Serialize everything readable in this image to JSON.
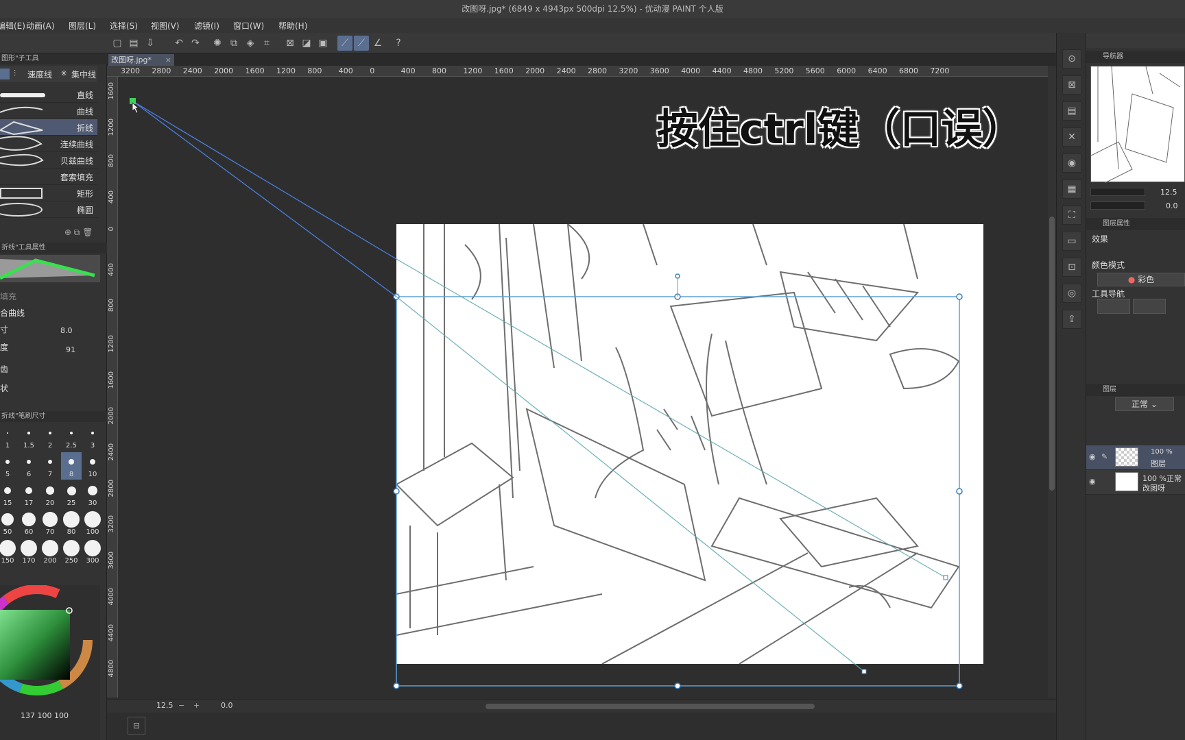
{
  "window": {
    "title": "改图呀.jpg* (6849 x 4943px 500dpi 12.5%)  - 优动漫 PAINT 个人版"
  },
  "menu": [
    "编辑(E)",
    "动画(A)",
    "图层(L)",
    "选择(S)",
    "视图(V)",
    "滤镜(I)",
    "窗口(W)",
    "帮助(H)"
  ],
  "subtool_panel": {
    "title": "图形\"子工具",
    "tabs": [
      "直线",
      "速度线",
      "集中线"
    ],
    "items": [
      "直线",
      "曲线",
      "折线",
      "连续曲线",
      "贝兹曲线",
      "套索填充",
      "矩形",
      "椭圆"
    ],
    "active_item": "折线"
  },
  "tool_property": {
    "title": "折线\"工具属性",
    "fill_label": "填充",
    "curve_label": "合曲线",
    "size_label": "寸",
    "size_value": "8.0",
    "opacity_label": "度",
    "opacity_value": "91",
    "antialias_label": "齿",
    "shape_label": "状"
  },
  "brush_size_panel": {
    "title": "折线\"笔刷尺寸",
    "sizes": [
      "1",
      "1.5",
      "2",
      "2.5",
      "3",
      "5",
      "6",
      "7",
      "8",
      "10",
      "15",
      "17",
      "20",
      "25",
      "30",
      "50",
      "60",
      "70",
      "80",
      "100",
      "150",
      "170",
      "200",
      "250",
      "300"
    ],
    "selected": "8"
  },
  "color_panel": {
    "readout": "137 100 100",
    "accent": "#3fd25a"
  },
  "document_tab": {
    "label": "改图呀.jpg*"
  },
  "hruler_labels": [
    "3200",
    "2800",
    "2400",
    "2000",
    "1600",
    "1200",
    "800",
    "400",
    "0",
    "400",
    "800",
    "1200",
    "1600",
    "2000",
    "2400",
    "2800",
    "3200",
    "3600",
    "4000",
    "4400",
    "4800",
    "5200",
    "5600",
    "6000",
    "6400",
    "6800",
    "7200"
  ],
  "vruler_labels": [
    "1600",
    "1200",
    "800",
    "400",
    "0",
    "400",
    "800",
    "1200",
    "1600",
    "2000",
    "2400",
    "2800",
    "3200",
    "3600",
    "4000",
    "4400",
    "4800"
  ],
  "overlay_caption": "按住ctrl键（口误）",
  "status": {
    "zoom": "12.5",
    "rotation": "0.0"
  },
  "navigator": {
    "title": "导航器",
    "zoom_value": "12.5",
    "rotation_value": "0.0"
  },
  "layer_property": {
    "title": "图层属性",
    "effect_label": "效果",
    "color_mode_label": "颜色模式",
    "color_mode_value": "彩色",
    "tool_nav_label": "工具导航"
  },
  "layers_panel": {
    "title": "图层",
    "blend_mode": "正常",
    "layers": [
      {
        "opacity": "100 %",
        "name": "图层",
        "active": true
      },
      {
        "opacity": "100 %正常",
        "name": "改图呀",
        "active": false
      }
    ]
  }
}
